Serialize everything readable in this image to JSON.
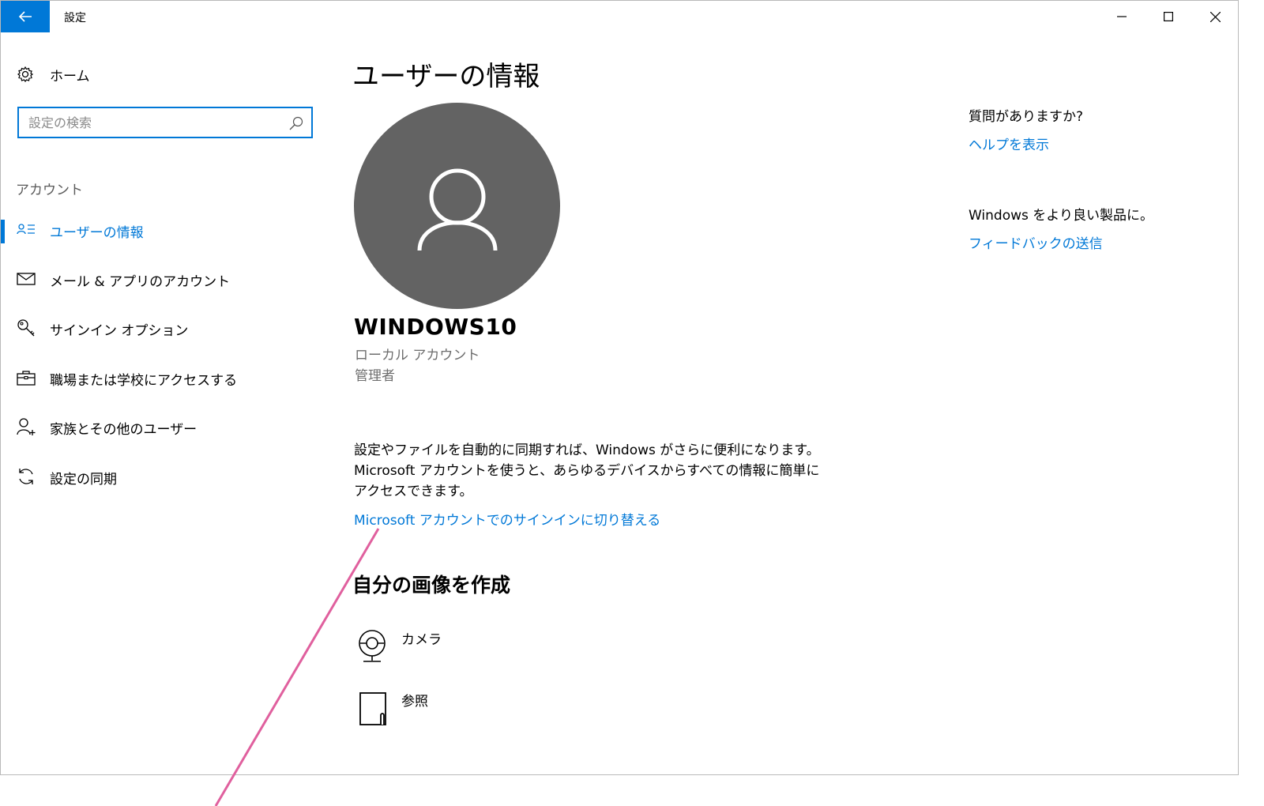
{
  "window": {
    "title": "設定"
  },
  "nav": {
    "home_label": "ホーム",
    "search_placeholder": "設定の検索",
    "section_label": "アカウント",
    "items": [
      {
        "label": "ユーザーの情報",
        "icon": "user-info-icon",
        "active": true
      },
      {
        "label": "メール & アプリのアカウント",
        "icon": "mail-icon",
        "active": false
      },
      {
        "label": "サインイン オプション",
        "icon": "key-icon",
        "active": false
      },
      {
        "label": "職場または学校にアクセスする",
        "icon": "briefcase-icon",
        "active": false
      },
      {
        "label": "家族とその他のユーザー",
        "icon": "add-user-icon",
        "active": false
      },
      {
        "label": "設定の同期",
        "icon": "sync-icon",
        "active": false
      }
    ]
  },
  "main": {
    "title": "ユーザーの情報",
    "user": {
      "name": "WINDOWS10",
      "account_type": "ローカル アカウント",
      "role": "管理者"
    },
    "info_text": "設定やファイルを自動的に同期すれば、Windows がさらに便利になります。Microsoft アカウントを使うと、あらゆるデバイスからすべての情報に簡単にアクセスできます。",
    "switch_link": "Microsoft アカウントでのサインインに切り替える",
    "picture_section_title": "自分の画像を作成",
    "picture_options": [
      {
        "label": "カメラ",
        "icon": "camera-icon"
      },
      {
        "label": "参照",
        "icon": "browse-icon"
      }
    ]
  },
  "side": {
    "help_question": "質問がありますか?",
    "help_link": "ヘルプを表示",
    "feedback_text": "Windows をより良い製品に。",
    "feedback_link": "フィードバックの送信"
  },
  "colors": {
    "accent": "#0078d7",
    "avatar_bg": "#636363",
    "annotation_line": "#e0609e"
  }
}
